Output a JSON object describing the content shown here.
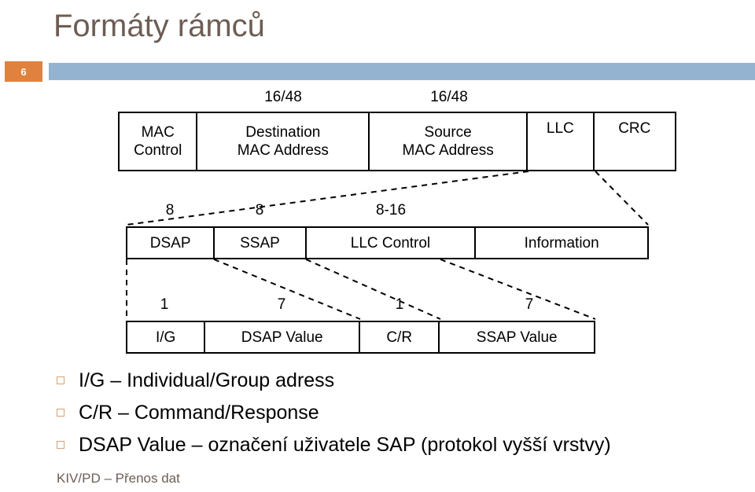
{
  "slide": {
    "title": "Formáty rámců",
    "number": "6",
    "footer": "KIV/PD – Přenos dat",
    "colors": {
      "title_text": "#6d5d54",
      "badge_background": "#e0813d",
      "header_rule": "#94b3d1",
      "bullet_marker": "#d8a074",
      "frame_border": "#000000",
      "footer_text": "#6d5d54"
    }
  },
  "diagram": {
    "rows": [
      {
        "name": "mac-frame",
        "size_labels": [
          "",
          "16/48",
          "16/48",
          "",
          ""
        ],
        "cells": [
          {
            "lines": [
              "MAC",
              "Control"
            ]
          },
          {
            "lines": [
              "Destination",
              "MAC Address"
            ]
          },
          {
            "lines": [
              "Source",
              "MAC Address"
            ]
          },
          {
            "lines": [
              "LLC"
            ]
          },
          {
            "lines": [
              "CRC"
            ]
          }
        ]
      },
      {
        "name": "llc-frame",
        "size_labels": [
          "8",
          "8",
          "8-16",
          ""
        ],
        "cells": [
          {
            "lines": [
              "DSAP"
            ]
          },
          {
            "lines": [
              "SSAP"
            ]
          },
          {
            "lines": [
              "LLC Control"
            ]
          },
          {
            "lines": [
              "Information"
            ]
          }
        ]
      },
      {
        "name": "sap-frame",
        "size_labels": [
          "1",
          "7",
          "1",
          "7"
        ],
        "cells": [
          {
            "lines": [
              "I/G"
            ]
          },
          {
            "lines": [
              "DSAP Value"
            ]
          },
          {
            "lines": [
              "C/R"
            ]
          },
          {
            "lines": [
              "SSAP Value"
            ]
          }
        ]
      }
    ]
  },
  "bullets": [
    {
      "text": "I/G – Individual/Group adress"
    },
    {
      "text": "C/R – Command/Response"
    },
    {
      "text": "DSAP Value – označení uživatele SAP (protokol vyšší vrstvy)"
    }
  ]
}
